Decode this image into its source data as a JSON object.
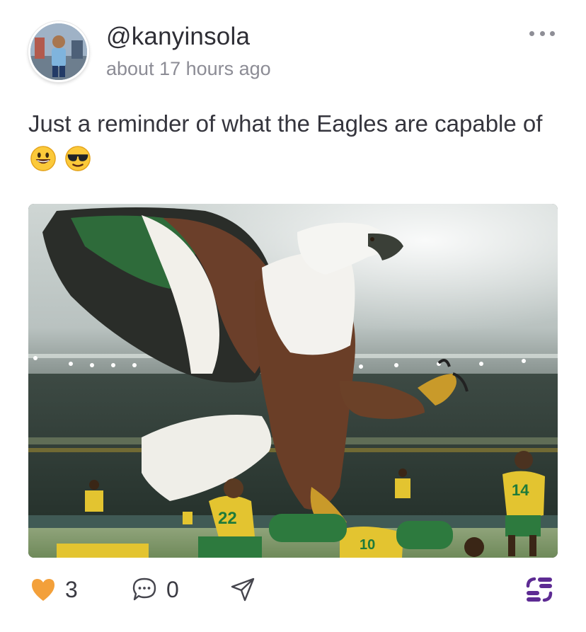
{
  "post": {
    "username": "@kanyinsola",
    "timestamp": "about 17 hours ago",
    "text": "Just a reminder of what the Eagles are capable of",
    "emojis": [
      "grinning-face",
      "smiling-face-with-sunglasses"
    ]
  },
  "image": {
    "jersey_numbers": [
      "22",
      "14",
      "10"
    ]
  },
  "actions": {
    "likes": "3",
    "comments": "0"
  },
  "colors": {
    "accent_heart": "#f3a03a",
    "brand": "#5d2b93",
    "muted": "#8c8c95"
  },
  "icons": {
    "menu": "ellipsis-icon",
    "like": "heart-icon",
    "comment": "speech-bubble-icon",
    "share": "paper-plane-icon",
    "brand": "app-logo-icon"
  }
}
